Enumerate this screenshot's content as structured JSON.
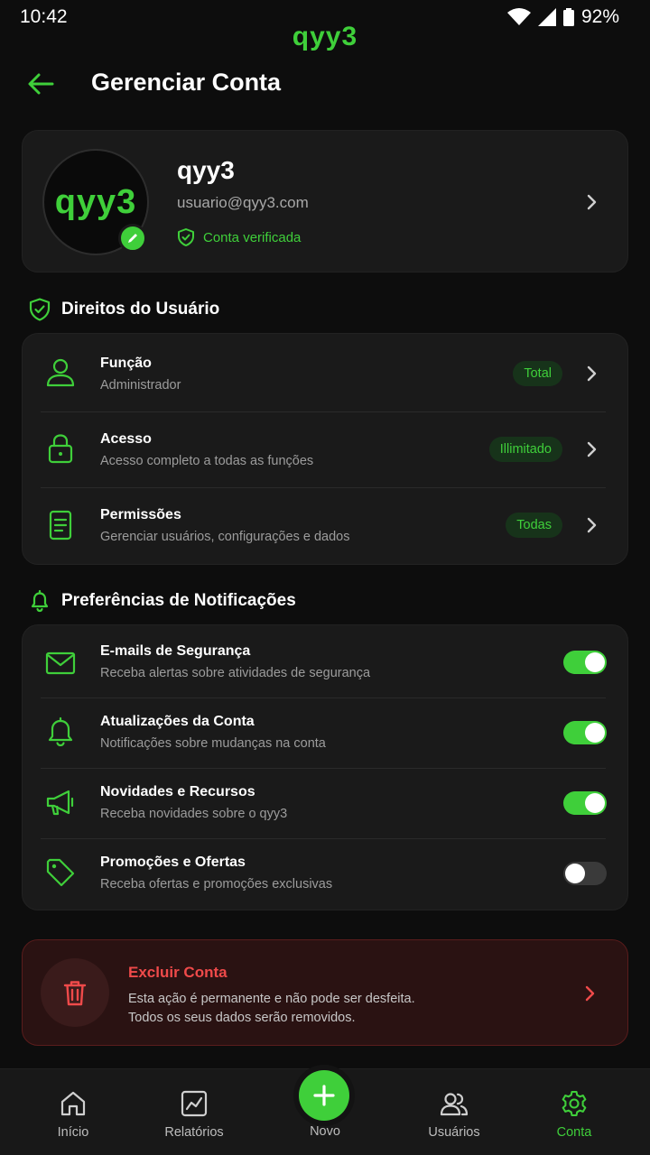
{
  "status": {
    "time": "10:42",
    "battery": "92%"
  },
  "brand": "qyy3",
  "header": {
    "title": "Gerenciar Conta"
  },
  "profile": {
    "avatar_text": "qyy3",
    "name": "qyy3",
    "email": "usuario@qyy3.com",
    "verified": "Conta verificada"
  },
  "rights": {
    "heading": "Direitos do Usuário",
    "items": [
      {
        "title": "Função",
        "subtitle": "Administrador",
        "badge": "Total",
        "icon": "user-icon"
      },
      {
        "title": "Acesso",
        "subtitle": "Acesso completo a todas as funções",
        "badge": "Illimitado",
        "icon": "lock-icon"
      },
      {
        "title": "Permissões",
        "subtitle": "Gerenciar usuários, configurações e dados",
        "badge": "Todas",
        "icon": "document-icon"
      }
    ]
  },
  "notifications": {
    "heading": "Preferências de Notificações",
    "items": [
      {
        "title": "E-mails de Segurança",
        "subtitle": "Receba alertas sobre atividades de segurança",
        "enabled": true,
        "icon": "mail-icon"
      },
      {
        "title": "Atualizações da Conta",
        "subtitle": "Notificações sobre mudanças na conta",
        "enabled": true,
        "icon": "bell-icon"
      },
      {
        "title": "Novidades e Recursos",
        "subtitle": "Receba novidades sobre o qyy3",
        "enabled": true,
        "icon": "megaphone-icon"
      },
      {
        "title": "Promoções e Ofertas",
        "subtitle": "Receba ofertas e promoções exclusivas",
        "enabled": false,
        "icon": "tag-icon"
      }
    ]
  },
  "danger": {
    "title": "Excluir Conta",
    "line1": "Esta ação é permanente e não pode ser desfeita.",
    "line2": "Todos os seus dados serão removidos."
  },
  "nav": {
    "home": "Início",
    "reports": "Relatórios",
    "new": "Novo",
    "users": "Usuários",
    "account": "Conta"
  },
  "colors": {
    "accent": "#3fcf3a",
    "danger": "#ef4a4a",
    "background": "#0d0d0d",
    "card": "#1a1a1a"
  }
}
